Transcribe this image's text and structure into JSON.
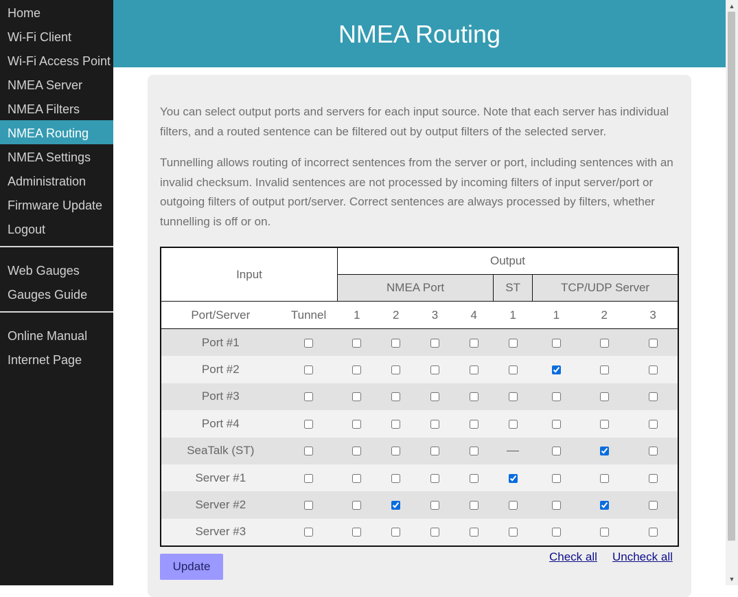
{
  "sidebar": {
    "group1": [
      "Home",
      "Wi-Fi Client",
      "Wi-Fi Access Point",
      "NMEA Server",
      "NMEA Filters",
      "NMEA Routing",
      "NMEA Settings",
      "Administration",
      "Firmware Update",
      "Logout"
    ],
    "group2": [
      "Web Gauges",
      "Gauges Guide"
    ],
    "group3": [
      "Online Manual",
      "Internet Page"
    ],
    "active": "NMEA Routing"
  },
  "header": {
    "title": "NMEA Routing"
  },
  "intro": {
    "p1": "You can select output ports and servers for each input source. Note that each server has individual filters, and a routed sentence can be filtered out by output filters of the selected server.",
    "p2": "Tunnelling allows routing of incorrect sentences from the server or port, including sentences with an invalid checksum. Invalid sentences are not processed by incoming filters of input server/port or outgoing filters of output port/server. Correct sentences are always processed by filters, whether tunnelling is off or on."
  },
  "table": {
    "input_label": "Input",
    "output_label": "Output",
    "groups": {
      "nmea_port": "NMEA Port",
      "st": "ST",
      "tcp": "TCP/UDP Server"
    },
    "col_headers": [
      "Port/Server",
      "Tunnel",
      "1",
      "2",
      "3",
      "4",
      "1",
      "1",
      "2",
      "3"
    ],
    "rows": [
      {
        "label": "Port #1",
        "checks": [
          false,
          false,
          false,
          false,
          false,
          false,
          false,
          false,
          false
        ]
      },
      {
        "label": "Port #2",
        "checks": [
          false,
          false,
          false,
          false,
          false,
          false,
          true,
          false,
          false
        ]
      },
      {
        "label": "Port #3",
        "checks": [
          false,
          false,
          false,
          false,
          false,
          false,
          false,
          false,
          false
        ]
      },
      {
        "label": "Port #4",
        "checks": [
          false,
          false,
          false,
          false,
          false,
          false,
          false,
          false,
          false
        ]
      },
      {
        "label": "SeaTalk (ST)",
        "checks": [
          false,
          false,
          false,
          false,
          false,
          null,
          false,
          true,
          false
        ]
      },
      {
        "label": "Server #1",
        "checks": [
          false,
          false,
          false,
          false,
          false,
          true,
          false,
          false,
          false
        ]
      },
      {
        "label": "Server #2",
        "checks": [
          false,
          false,
          true,
          false,
          false,
          false,
          false,
          true,
          false
        ]
      },
      {
        "label": "Server #3",
        "checks": [
          false,
          false,
          false,
          false,
          false,
          false,
          false,
          false,
          false
        ]
      }
    ]
  },
  "footer": {
    "update_label": "Update",
    "check_all": "Check all",
    "uncheck_all": "Uncheck all"
  },
  "colors": {
    "accent": "#359bb2",
    "sidebar_bg": "#1b1b1b",
    "update_button": "#9b98ff"
  }
}
